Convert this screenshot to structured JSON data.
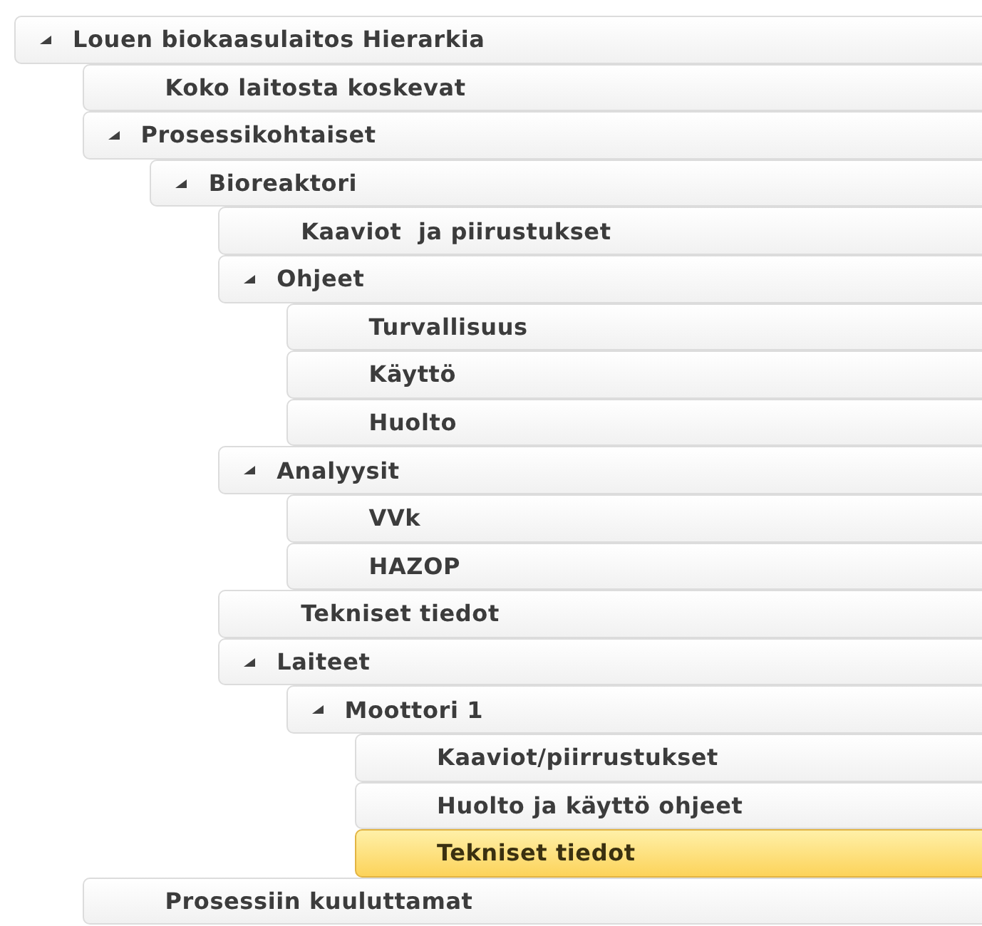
{
  "tree": [
    {
      "label": "Louen biokaasulaitos Hierarkia",
      "expanded": true,
      "selected": false,
      "children": [
        {
          "label": "Koko laitosta koskevat",
          "selected": false
        },
        {
          "label": "Prosessikohtaiset",
          "expanded": true,
          "selected": false,
          "children": [
            {
              "label": "Bioreaktori",
              "expanded": true,
              "selected": false,
              "children": [
                {
                  "label": "Kaaviot  ja piirustukset",
                  "selected": false
                },
                {
                  "label": "Ohjeet",
                  "expanded": true,
                  "selected": false,
                  "children": [
                    {
                      "label": "Turvallisuus",
                      "selected": false
                    },
                    {
                      "label": "Käyttö",
                      "selected": false
                    },
                    {
                      "label": "Huolto",
                      "selected": false
                    }
                  ]
                },
                {
                  "label": "Analyysit",
                  "expanded": true,
                  "selected": false,
                  "children": [
                    {
                      "label": "VVk",
                      "selected": false
                    },
                    {
                      "label": "HAZOP",
                      "selected": false
                    }
                  ]
                },
                {
                  "label": "Tekniset tiedot",
                  "selected": false
                },
                {
                  "label": "Laiteet",
                  "expanded": true,
                  "selected": false,
                  "children": [
                    {
                      "label": "Moottori 1",
                      "expanded": true,
                      "selected": false,
                      "children": [
                        {
                          "label": "Kaaviot/piirrustukset",
                          "selected": false
                        },
                        {
                          "label": "Huolto ja käyttö ohjeet",
                          "selected": false
                        },
                        {
                          "label": "Tekniset tiedot",
                          "selected": true
                        }
                      ]
                    }
                  ]
                }
              ]
            }
          ]
        },
        {
          "label": "Prosessiin kuuluttamat",
          "selected": false
        }
      ]
    }
  ]
}
